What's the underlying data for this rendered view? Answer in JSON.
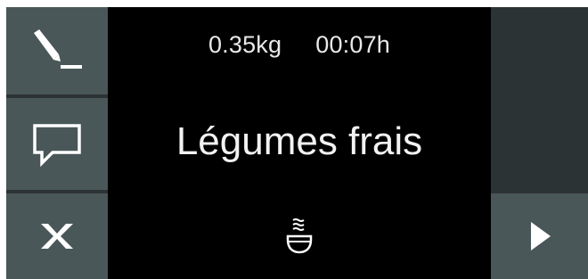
{
  "status": {
    "weight": "0.35kg",
    "duration": "00:07h"
  },
  "program": {
    "name": "Légumes frais",
    "mode_icon": "steam-bowl-icon"
  },
  "sidebar": {
    "buttons": [
      {
        "icon": "edit-pen-icon"
      },
      {
        "icon": "speech-bubble-icon"
      },
      {
        "icon": "close-x-icon"
      }
    ]
  },
  "navigation": {
    "next_icon": "play-triangle-icon"
  },
  "colors": {
    "background": "#000000",
    "button": "#4a5758",
    "panel": "#2c3335",
    "text": "#f2f2f2"
  }
}
